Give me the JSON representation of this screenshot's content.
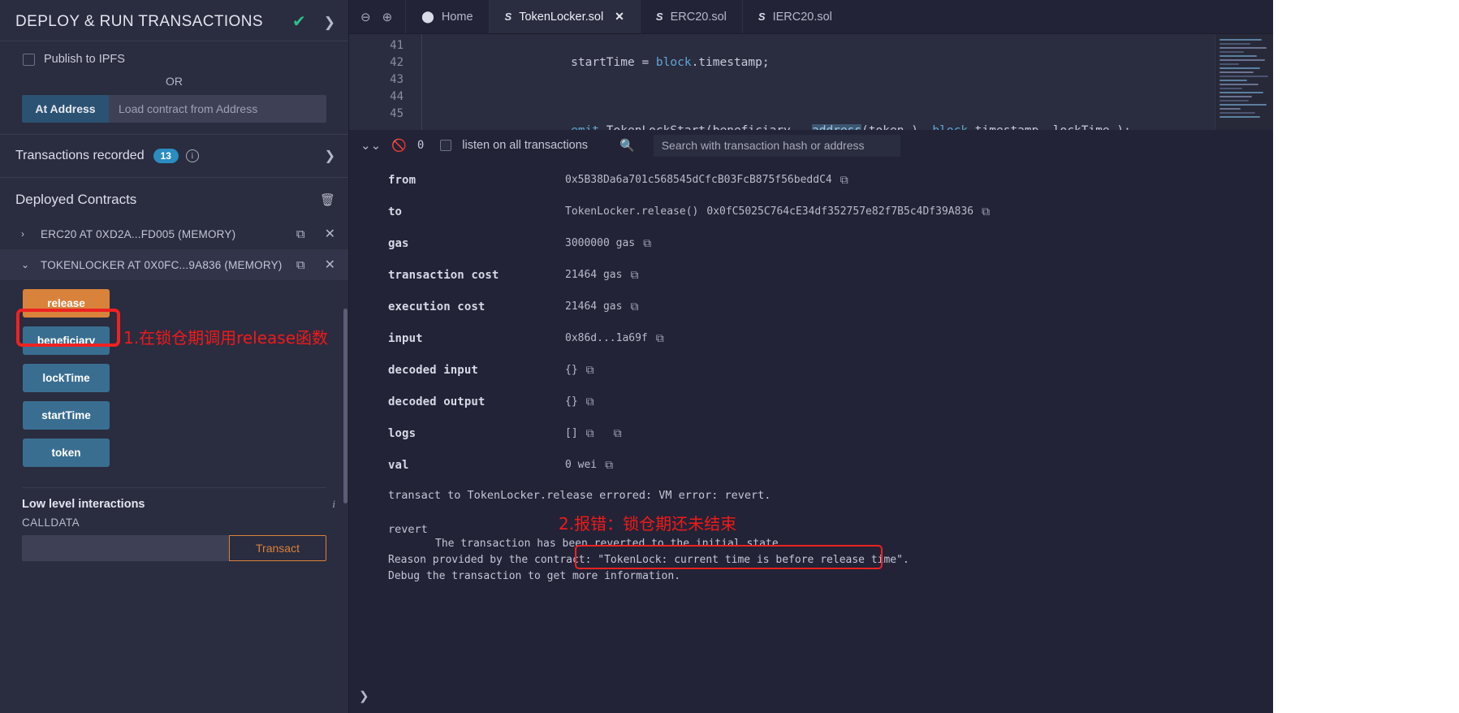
{
  "sidebar": {
    "title": "DEPLOY & RUN TRANSACTIONS",
    "check_icon": "check-icon",
    "chevron_icon": "chevron-right-icon",
    "publish_ipfs_label": "Publish to IPFS",
    "or_label": "OR",
    "at_address_button": "At Address",
    "at_address_placeholder": "Load contract from Address",
    "transactions_recorded_label": "Transactions recorded",
    "transactions_recorded_count": "13",
    "deployed_contracts_label": "Deployed Contracts",
    "contracts": [
      {
        "name": "ERC20 AT 0XD2A...FD005 (MEMORY)",
        "caret": "›",
        "selected": false
      },
      {
        "name": "TOKENLOCKER AT 0X0FC...9A836 (MEMORY)",
        "caret": "⌄",
        "selected": true
      }
    ],
    "functions": [
      {
        "label": "release",
        "kind": "orange"
      },
      {
        "label": "beneficiary",
        "kind": "blue"
      },
      {
        "label": "lockTime",
        "kind": "blue"
      },
      {
        "label": "startTime",
        "kind": "blue"
      },
      {
        "label": "token",
        "kind": "blue"
      }
    ],
    "low_level_title": "Low level interactions",
    "calldata_label": "CALLDATA",
    "calldata_value": "",
    "transact_button": "Transact"
  },
  "annotations": {
    "step1": "1.在锁仓期调用release函数",
    "step2": "2.报错：锁仓期还未结束",
    "color": "#f01a1a"
  },
  "tabbar": {
    "zoom_out_icon": "zoom-out-icon",
    "zoom_in_icon": "zoom-in-icon",
    "tabs": [
      {
        "label": "Home",
        "icon": "home-icon",
        "active": false,
        "closable": false
      },
      {
        "label": "TokenLocker.sol",
        "icon": "solidity-icon",
        "active": true,
        "closable": true
      },
      {
        "label": "ERC20.sol",
        "icon": "solidity-icon",
        "active": false,
        "closable": false
      },
      {
        "label": "IERC20.sol",
        "icon": "solidity-icon",
        "active": false,
        "closable": false
      }
    ]
  },
  "editor": {
    "line_numbers": [
      "41",
      "42",
      "43",
      "44",
      "45"
    ],
    "lines": [
      {
        "num": "41",
        "indent": "        ",
        "parts": [
          {
            "t": "startTime = ",
            "c": "plain"
          },
          {
            "t": "block",
            "c": "kw"
          },
          {
            "t": ".timestamp;",
            "c": "plain"
          }
        ]
      },
      {
        "num": "42",
        "indent": "",
        "parts": []
      },
      {
        "num": "43",
        "indent": "        ",
        "parts": [
          {
            "t": "emit",
            "c": "kw"
          },
          {
            "t": " TokenLockStart(beneficiary_, ",
            "c": "plain"
          },
          {
            "t": "address",
            "c": "hl"
          },
          {
            "t": "(token_), ",
            "c": "plain"
          },
          {
            "t": "block",
            "c": "kw"
          },
          {
            "t": ".timestamp, lockTime_);",
            "c": "plain"
          }
        ]
      },
      {
        "num": "44",
        "indent": "    ",
        "parts": [
          {
            "t": "}",
            "c": "plain"
          }
        ]
      },
      {
        "num": "45",
        "indent": "",
        "parts": []
      }
    ]
  },
  "tx_toolbar": {
    "collapse_icon": "chevrons-down-icon",
    "clear_icon": "ban-icon",
    "count": "0",
    "listen_label": "listen on all transactions",
    "search_icon": "search-icon",
    "search_placeholder": "Search with transaction hash or address"
  },
  "transaction": {
    "rows": [
      {
        "key": "from",
        "value": "0x5B38Da6a701c568545dCfcB03FcB875f56beddC4",
        "copy": true,
        "extra": ""
      },
      {
        "key": "to",
        "value": "TokenLocker.release()",
        "copy": true,
        "extra": "0x0fC5025C764cE34df352757e82f7B5c4Df39A836"
      },
      {
        "key": "gas",
        "value": "3000000 gas",
        "copy": true,
        "extra": ""
      },
      {
        "key": "transaction cost",
        "value": "21464 gas",
        "copy": true,
        "extra": ""
      },
      {
        "key": "execution cost",
        "value": "21464 gas",
        "copy": true,
        "extra": ""
      },
      {
        "key": "input",
        "value": "0x86d...1a69f",
        "copy": true,
        "extra": ""
      },
      {
        "key": "decoded input",
        "value": "{}",
        "copy": true,
        "extra": ""
      },
      {
        "key": "decoded output",
        "value": "{}",
        "copy": true,
        "extra": ""
      },
      {
        "key": "logs",
        "value": "[]",
        "copy": true,
        "copy2": true,
        "extra": ""
      },
      {
        "key": "val",
        "value": "0 wei",
        "copy": true,
        "extra": ""
      }
    ],
    "error_line": "transact to TokenLocker.release errored: VM error: revert.",
    "revert_label": "revert",
    "error_detail_1": "The transaction has been reverted to the initial state.",
    "error_detail_2_prefix": "Reason provided by the contract:",
    "error_detail_2_reason": "\"TokenLock: current time is before release time\".",
    "error_detail_3": "Debug the transaction to get more information."
  }
}
